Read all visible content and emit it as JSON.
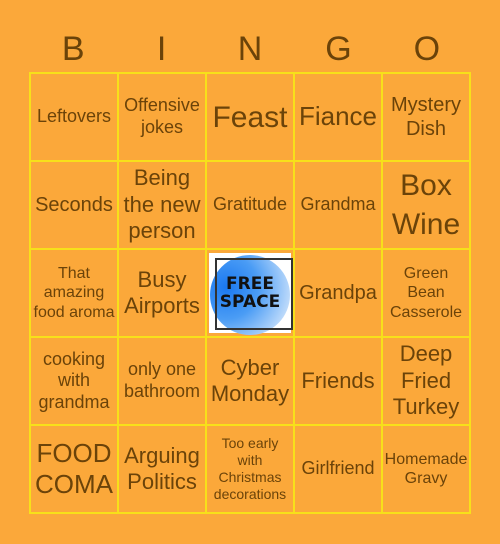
{
  "header": {
    "letters": [
      "B",
      "I",
      "N",
      "G",
      "O"
    ]
  },
  "free_space": {
    "label_line1": "FREE",
    "label_line2": "SPACE"
  },
  "colors": {
    "background": "#FBA83A",
    "text": "#6B4309",
    "grid_lines": "#F7E01A"
  },
  "cells": [
    [
      "Leftovers",
      "Offensive jokes",
      "Feast",
      "Fiance",
      "Mystery Dish"
    ],
    [
      "Seconds",
      "Being the new person",
      "Gratitude",
      "Grandma",
      "Box Wine"
    ],
    [
      "That amazing food aroma",
      "Busy Airports",
      "FREE SPACE",
      "Grandpa",
      "Green Bean Casserole"
    ],
    [
      "cooking with grandma",
      "only one bathroom",
      "Cyber Monday",
      "Friends",
      "Deep Fried Turkey"
    ],
    [
      "FOOD COMA",
      "Arguing Politics",
      "Too early with Christmas decorations",
      "Girlfriend",
      "Homemade Gravy"
    ]
  ]
}
